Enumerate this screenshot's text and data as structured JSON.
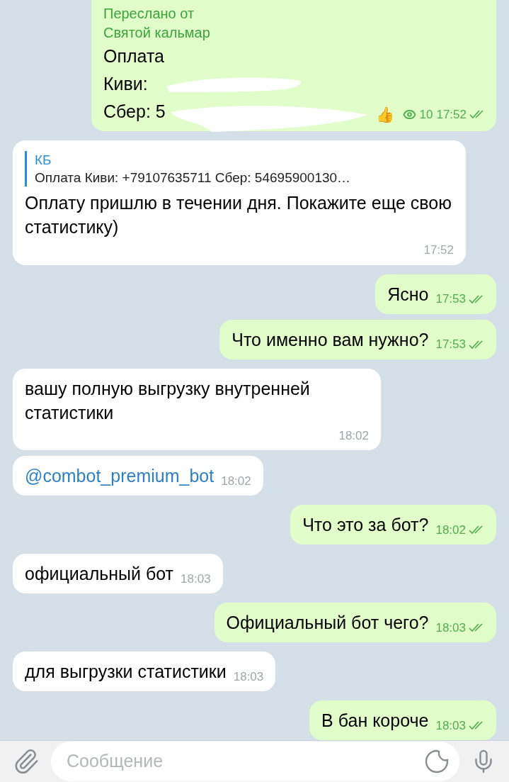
{
  "forwarded": {
    "label": "Переслано от",
    "sender": "Святой кальмар",
    "lines": [
      "Оплата",
      "Киви:",
      "Сбер: 5"
    ],
    "reaction": "👍",
    "views": "10",
    "time": "17:52",
    "read": true
  },
  "messages": [
    {
      "kind": "incoming",
      "reply": {
        "name": "КБ",
        "text": "Оплата Киви: +79107635711 Сбер: 54695900130…"
      },
      "text": "Оплату пришлю в течении дня. Покажите еще свою статистику)",
      "time": "17:52"
    },
    {
      "kind": "outgoing",
      "text": "Ясно",
      "time": "17:53",
      "read": true
    },
    {
      "kind": "outgoing",
      "text": "Что именно вам нужно?",
      "time": "17:53",
      "read": true
    },
    {
      "kind": "incoming",
      "text": "вашу полную выгрузку внутренней статистики",
      "time": "18:02"
    },
    {
      "kind": "incoming",
      "link": true,
      "text": "@combot_premium_bot",
      "time": "18:02"
    },
    {
      "kind": "outgoing",
      "text": "Что это за бот?",
      "time": "18:02",
      "read": true
    },
    {
      "kind": "incoming",
      "text": "официальный бот",
      "time": "18:03"
    },
    {
      "kind": "outgoing",
      "text": "Официальный бот чего?",
      "time": "18:03",
      "read": true
    },
    {
      "kind": "incoming",
      "text": "для выгрузки статистики",
      "time": "18:03"
    },
    {
      "kind": "outgoing",
      "text": "В бан короче",
      "time": "18:03",
      "read": true
    }
  ],
  "composer": {
    "placeholder": "Сообщение"
  }
}
